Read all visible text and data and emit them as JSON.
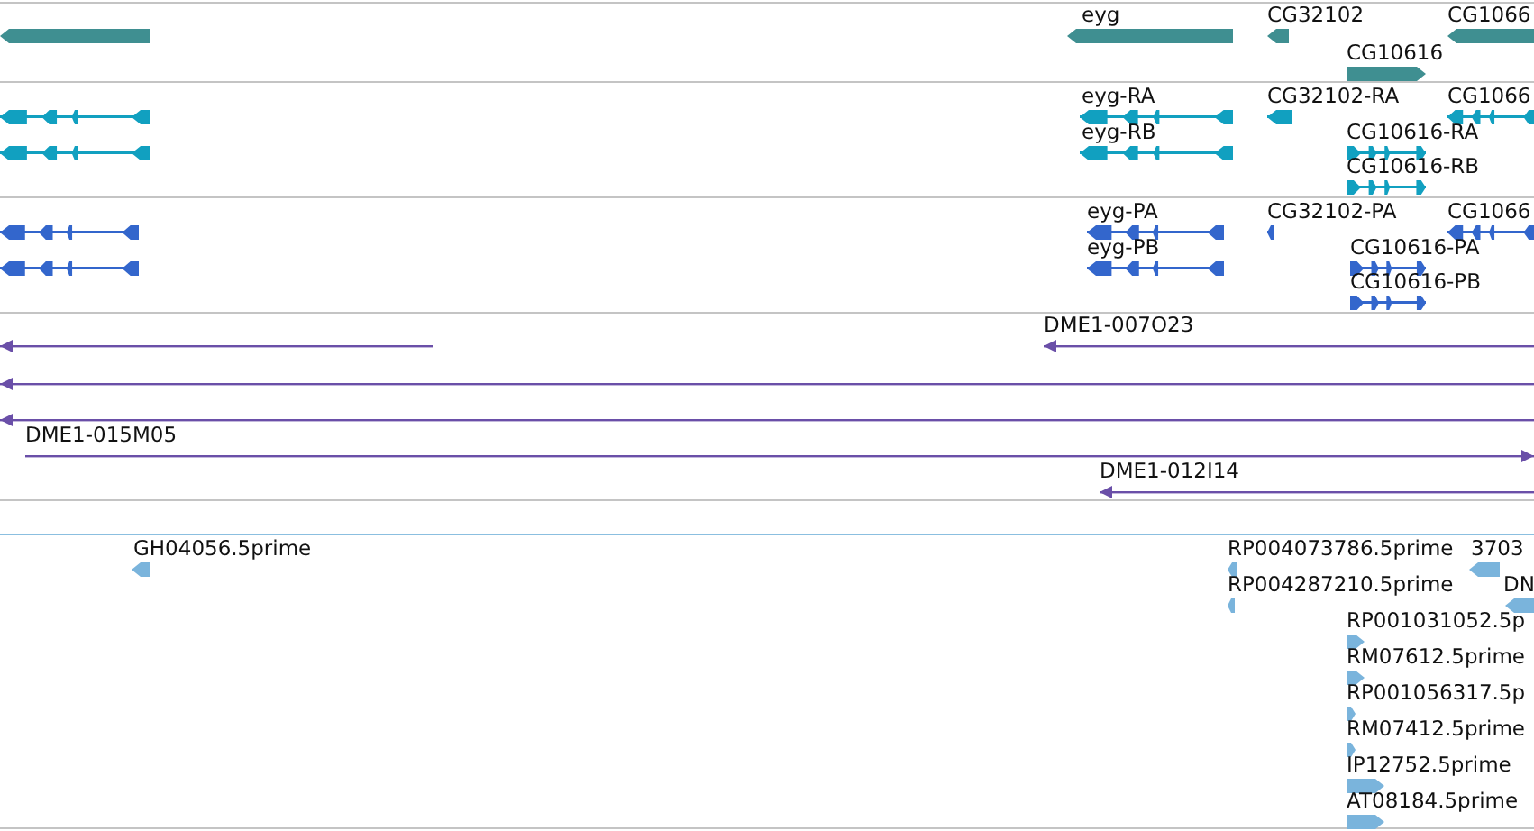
{
  "tracks": [
    {
      "kind": "gene",
      "color": "#3f8f91",
      "features": [
        {
          "reverse": true
        },
        {
          "label": "eyg",
          "reverse": true
        },
        {
          "label": "CG32102",
          "reverse": true
        },
        {
          "label": "CG1066",
          "reverse": true
        },
        {
          "label": "CG10616",
          "reverse": false
        }
      ]
    },
    {
      "kind": "transcript",
      "color": "#11a0c0",
      "features": [
        {
          "reverse": true
        },
        {
          "reverse": true
        },
        {
          "label": "eyg-RA",
          "reverse": true
        },
        {
          "label": "eyg-RB",
          "reverse": true
        },
        {
          "label": "CG32102-RA",
          "reverse": true
        },
        {
          "label": "CG1066",
          "reverse": true
        },
        {
          "label": "CG10616-RA",
          "reverse": false
        },
        {
          "label": "CG10616-RB",
          "reverse": false
        }
      ]
    },
    {
      "kind": "transcript",
      "color": "#3366cc",
      "features": [
        {
          "reverse": true
        },
        {
          "reverse": true
        },
        {
          "label": "eyg-PA",
          "reverse": true
        },
        {
          "label": "eyg-PB",
          "reverse": true
        },
        {
          "label": "CG32102-PA",
          "reverse": true
        },
        {
          "label": "CG1066",
          "reverse": true
        },
        {
          "label": "CG10616-PA",
          "reverse": false
        },
        {
          "label": "CG10616-PB",
          "reverse": false
        }
      ]
    },
    {
      "kind": "clone",
      "color": "#6a4fa8",
      "features": [
        {
          "reverse": true
        },
        {
          "label": "DME1-007O23",
          "reverse": true
        },
        {
          "reverse": true
        },
        {
          "reverse": true
        },
        {
          "label": "DME1-015M05",
          "reverse": false
        },
        {
          "label": "DME1-012I14",
          "reverse": true
        }
      ]
    },
    {
      "kind": "est",
      "color": "#7ab4dc",
      "features": [
        {
          "label": "GH04056.5prime",
          "reverse": true
        },
        {
          "label": "RP004073786.5prime",
          "reverse": true
        },
        {
          "label": "3703",
          "reverse": true
        },
        {
          "label": "RP004287210.5prime",
          "reverse": true
        },
        {
          "label": "DN",
          "reverse": true
        },
        {
          "label": "RP001031052.5p",
          "reverse": false
        },
        {
          "label": "RM07612.5prime",
          "reverse": false
        },
        {
          "label": "RP001056317.5p",
          "reverse": false
        },
        {
          "label": "RM07412.5prime",
          "reverse": false
        },
        {
          "label": "IP12752.5prime",
          "reverse": false
        },
        {
          "label": "AT08184.5prime",
          "reverse": false
        }
      ]
    }
  ]
}
